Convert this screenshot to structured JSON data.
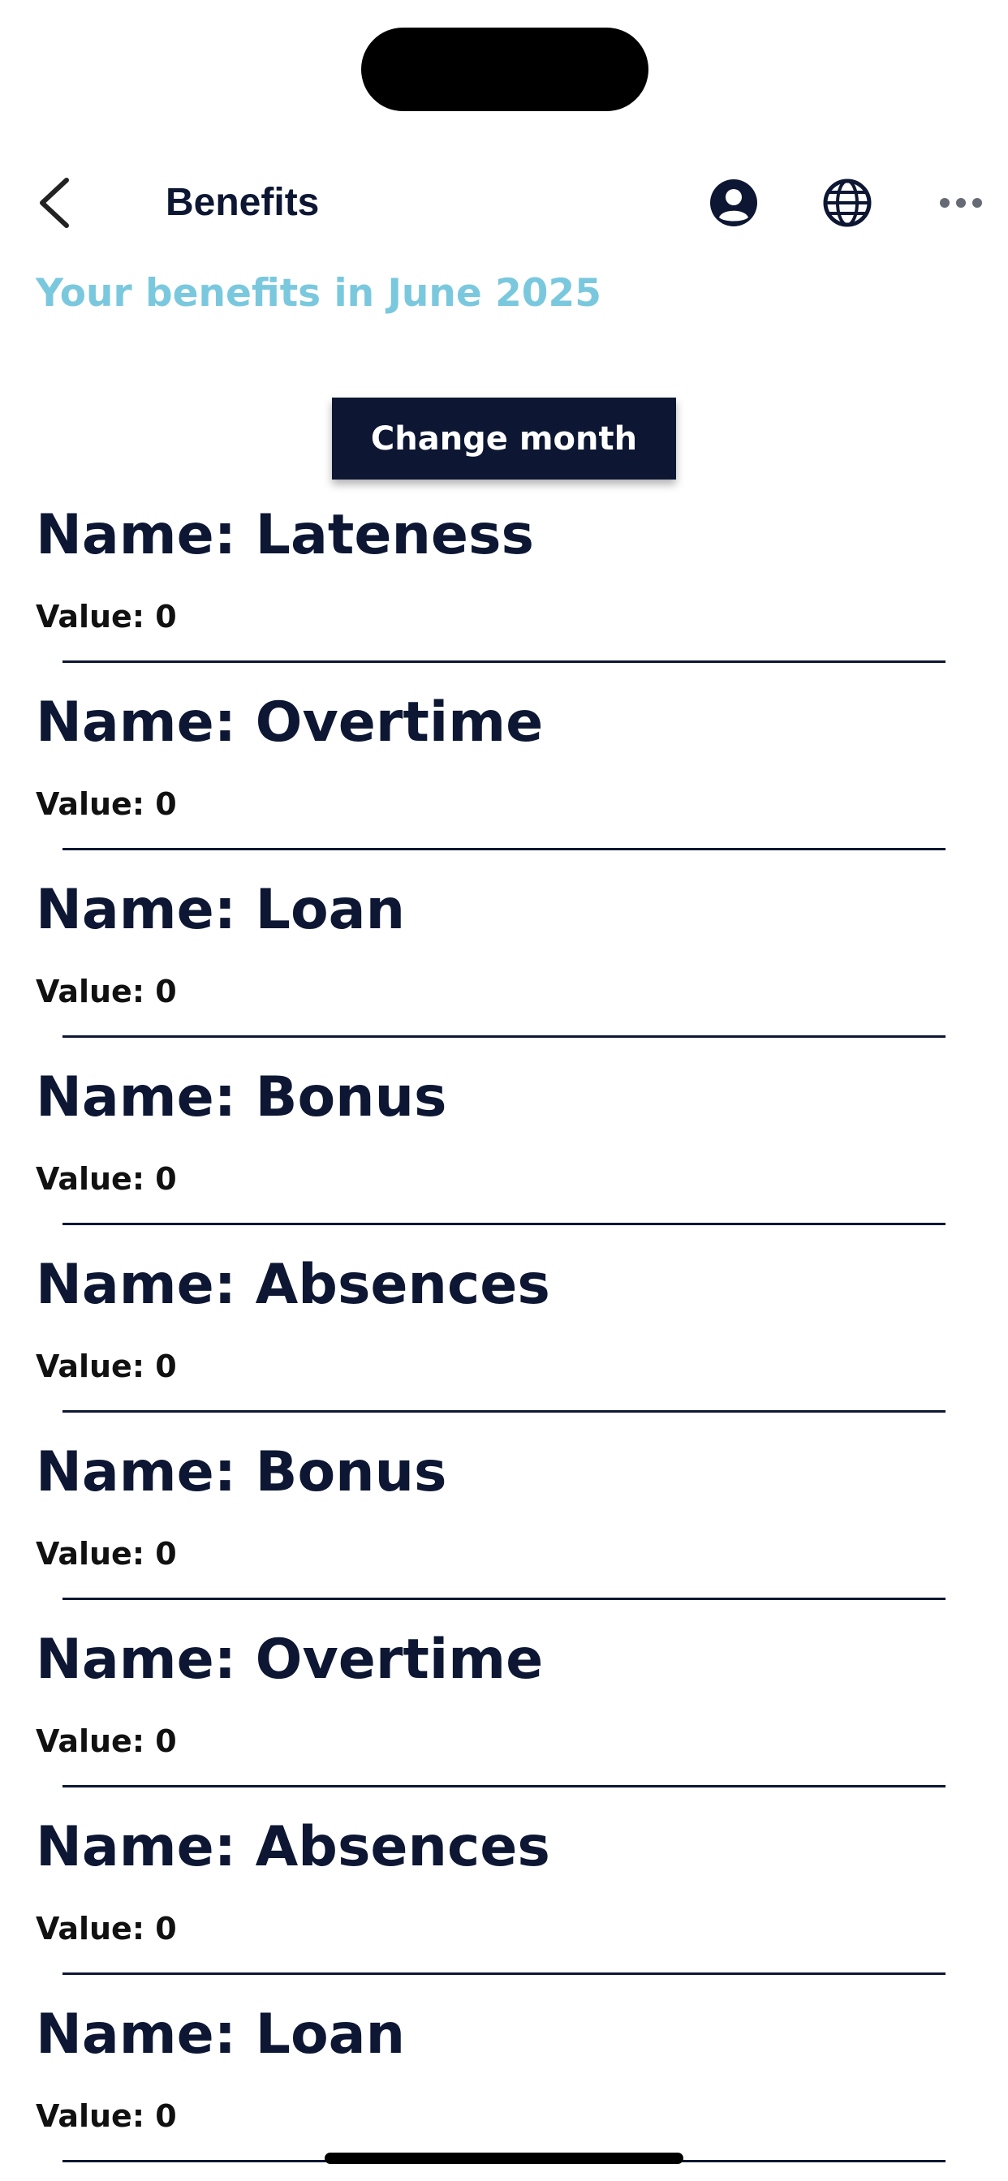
{
  "header": {
    "title": "Benefits",
    "subtitle": "Your benefits in June 2025"
  },
  "actions": {
    "change_month_label": "Change month"
  },
  "icons": {
    "back": "chevron-left-icon",
    "profile": "user-circle-icon",
    "language": "globe-icon",
    "more": "more-horizontal-icon"
  },
  "colors": {
    "primary": "#0d1733",
    "accent": "#7ac8de",
    "background": "#ffffff"
  },
  "benefits": [
    {
      "name": "Name: Lateness",
      "value": "Value: 0"
    },
    {
      "name": "Name: Overtime",
      "value": "Value: 0"
    },
    {
      "name": "Name: Loan",
      "value": "Value: 0"
    },
    {
      "name": "Name: Bonus",
      "value": "Value: 0"
    },
    {
      "name": "Name: Absences",
      "value": "Value: 0"
    },
    {
      "name": "Name: Bonus",
      "value": "Value: 0"
    },
    {
      "name": "Name: Overtime",
      "value": "Value: 0"
    },
    {
      "name": "Name: Absences",
      "value": "Value: 0"
    },
    {
      "name": "Name: Loan",
      "value": "Value: 0"
    }
  ]
}
